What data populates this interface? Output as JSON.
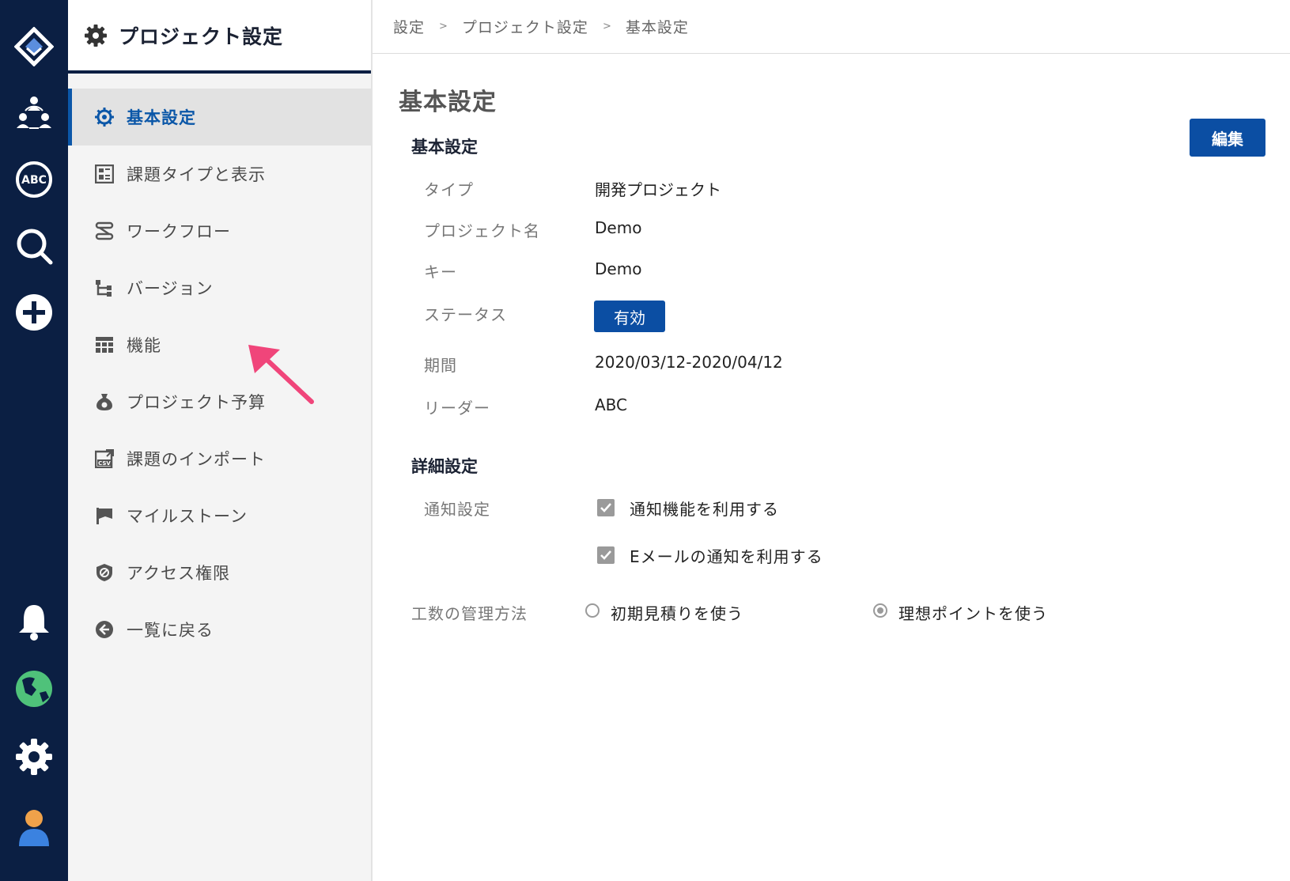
{
  "sidebar": {
    "title": "プロジェクト設定",
    "items": [
      {
        "label": "基本設定",
        "icon": "gear-badge-icon",
        "active": true
      },
      {
        "label": "課題タイプと表示",
        "icon": "issue-type-icon"
      },
      {
        "label": "ワークフロー",
        "icon": "workflow-icon"
      },
      {
        "label": "バージョン",
        "icon": "version-icon"
      },
      {
        "label": "機能",
        "icon": "features-icon"
      },
      {
        "label": "プロジェクト予算",
        "icon": "budget-icon"
      },
      {
        "label": "課題のインポート",
        "icon": "csv-import-icon"
      },
      {
        "label": "マイルストーン",
        "icon": "flag-icon"
      },
      {
        "label": "アクセス権限",
        "icon": "shield-icon"
      },
      {
        "label": "一覧に戻る",
        "icon": "back-arrow-icon"
      }
    ]
  },
  "breadcrumb": [
    "設定",
    "プロジェクト設定",
    "基本設定"
  ],
  "breadcrumb_separator": ">",
  "main": {
    "page_title": "基本設定",
    "edit_label": "編集",
    "basic_section": {
      "title": "基本設定",
      "fields": [
        {
          "label": "タイプ",
          "value": "開発プロジェクト"
        },
        {
          "label": "プロジェクト名",
          "value": "Demo"
        },
        {
          "label": "キー",
          "value": "Demo"
        },
        {
          "label": "ステータス",
          "value": "有効"
        },
        {
          "label": "期間",
          "value": "2020/03/12-2020/04/12"
        },
        {
          "label": "リーダー",
          "value": "ABC"
        }
      ]
    },
    "detail_section": {
      "title": "詳細設定",
      "notify_label": "通知設定",
      "notify_options": [
        {
          "label": "通知機能を利用する",
          "checked": true
        },
        {
          "label": "Eメールの通知を利用する",
          "checked": true
        }
      ],
      "effort_label": "工数の管理方法",
      "effort_options": [
        {
          "label": "初期見積りを使う",
          "selected": false
        },
        {
          "label": "理想ポイントを使う",
          "selected": true
        }
      ]
    }
  },
  "rail": {
    "abc_text": "ABC",
    "icons": [
      "logo-icon",
      "team-icon",
      "abc-icon",
      "search-icon",
      "add-icon",
      "bell-icon",
      "globe-icon",
      "gear-icon",
      "user-avatar-icon"
    ]
  },
  "colors": {
    "navy": "#0b1f43",
    "accent": "#0b4ea3",
    "annotation_arrow": "#f0457a"
  }
}
